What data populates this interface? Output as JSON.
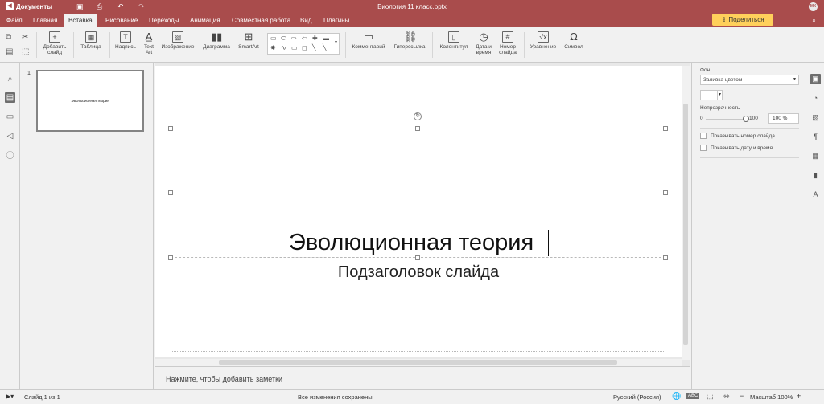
{
  "app": {
    "name": "Документы",
    "doc_title": "Биология 11 класс.pptx",
    "avatar": "МК"
  },
  "menu": {
    "tabs": [
      "Файл",
      "Главная",
      "Вставка",
      "Рисование",
      "Переходы",
      "Анимация",
      "Совместная работа",
      "Вид",
      "Плагины"
    ],
    "active_tab": "Вставка",
    "share_label": "Поделиться"
  },
  "ribbon": {
    "add_slide": [
      "Добавить",
      "слайд"
    ],
    "table": "Таблица",
    "textbox": "Надпись",
    "textart": [
      "Text",
      "Art"
    ],
    "image": "Изображение",
    "chart": "Диаграмма",
    "smartart": "SmartArt",
    "comment": "Комментарий",
    "hyperlink": "Гиперссылка",
    "header_footer": "Колонтитул",
    "datetime": [
      "Дата и",
      "время"
    ],
    "slide_number": [
      "Номер",
      "слайда"
    ],
    "equation": "Уравнение",
    "symbol": "Символ"
  },
  "thumbnails": [
    {
      "number": "1",
      "title": "Эволюционная теория"
    }
  ],
  "slide": {
    "title": "Эволюционная теория",
    "subtitle": "Подзаголовок слайда"
  },
  "notes_placeholder": "Нажмите, чтобы добавить заметки",
  "right_panel": {
    "background_label": "Фон",
    "fill_value": "Заливка цветом",
    "opacity_label": "Непрозрачность",
    "opacity_min": "0",
    "opacity_max": "100",
    "opacity_value": "100 %",
    "opacity_level": 1.0,
    "show_slide_number": "Показывать номер слайда",
    "show_datetime": "Показывать дату и время"
  },
  "status": {
    "slide_counter": "Слайд 1 из 1",
    "saved": "Все изменения сохранены",
    "language": "Русский (Россия)",
    "zoom": "Масштаб 100%"
  },
  "colors": {
    "brand": "#a94c4c",
    "share": "#ffd05b"
  }
}
